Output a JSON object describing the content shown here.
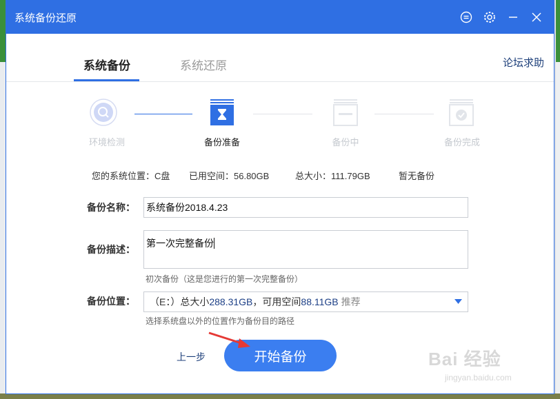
{
  "window": {
    "title": "系统备份还原",
    "accent": "#2f6fe3"
  },
  "titlebar_icons": [
    "feedback-icon",
    "gear-icon",
    "minimize-icon",
    "close-icon"
  ],
  "tabs": [
    {
      "label": "系统备份",
      "active": true
    },
    {
      "label": "系统还原",
      "active": false
    }
  ],
  "forum_link": "论坛求助",
  "steps": [
    {
      "label": "环境检测",
      "state": "done"
    },
    {
      "label": "备份准备",
      "state": "current"
    },
    {
      "label": "备份中",
      "state": "pending"
    },
    {
      "label": "备份完成",
      "state": "pending"
    }
  ],
  "system_info": {
    "location": "您的系统位置：C盘",
    "used": "已用空间：56.80GB",
    "total": "总大小：111.79GB",
    "backup": "暂无备份"
  },
  "form": {
    "name_label": "备份名称：",
    "name_value": "系统备份2018.4.23",
    "desc_label": "备份描述：",
    "desc_value": "第一次完整备份",
    "desc_hint": "初次备份（这是您进行的第一次完整备份）",
    "location_label": "备份位置：",
    "location_value": {
      "prefix": "（E：）总大小",
      "total": "288.31GB",
      "middle": "，可用空间",
      "free": "88.11GB",
      "suffix": "推荐"
    },
    "location_hint": "选择系统盘以外的位置作为备份目的路径"
  },
  "buttons": {
    "prev": "上一步",
    "start": "开始备份"
  },
  "watermark": {
    "text": "Bai 经验",
    "url": "jingyan.baidu.com"
  }
}
